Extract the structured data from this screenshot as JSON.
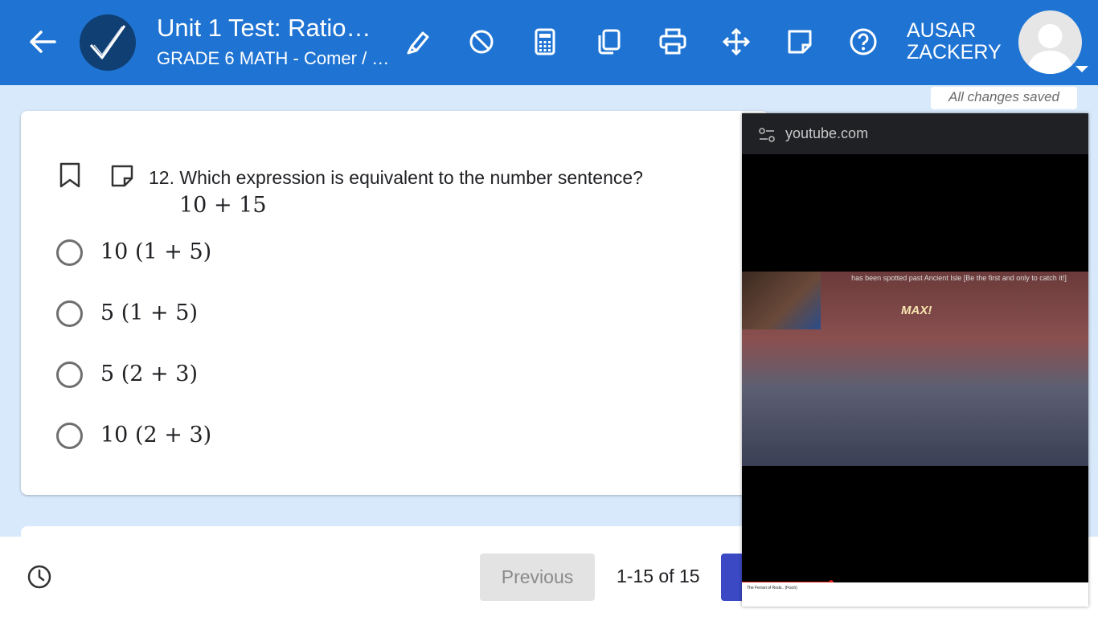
{
  "header": {
    "title": "Unit 1 Test: Ratio…",
    "subtitle": "GRADE 6 MATH - Comer / …",
    "user_name_line1": "AUSAR",
    "user_name_line2": "ZACKERY",
    "tools": [
      "highlighter-icon",
      "block-icon",
      "calculator-icon",
      "copy-icon",
      "print-icon",
      "move-icon",
      "sticky-note-icon",
      "help-icon"
    ],
    "color": "#1f74d3"
  },
  "status": {
    "saved": "All changes saved"
  },
  "question": {
    "number_text": "12. Which expression is equivalent to the number sentence?",
    "expression": "10 + 15",
    "options": [
      {
        "label": "10 (1 + 5)"
      },
      {
        "label": "5 (1 + 5)"
      },
      {
        "label": "5 (2 + 3)"
      },
      {
        "label": "10 (2 + 3)"
      }
    ]
  },
  "footer": {
    "previous_label": "Previous",
    "page_count": "1-15 of 15",
    "next_color": "#3b49c5"
  },
  "video": {
    "url": "youtube.com",
    "game_text": "has been spotted past Ancient Isle [Be the first and only to catch it!]",
    "max_label": "MAX!",
    "caption": "The Ferrari of Rods.. (Fisch)"
  }
}
